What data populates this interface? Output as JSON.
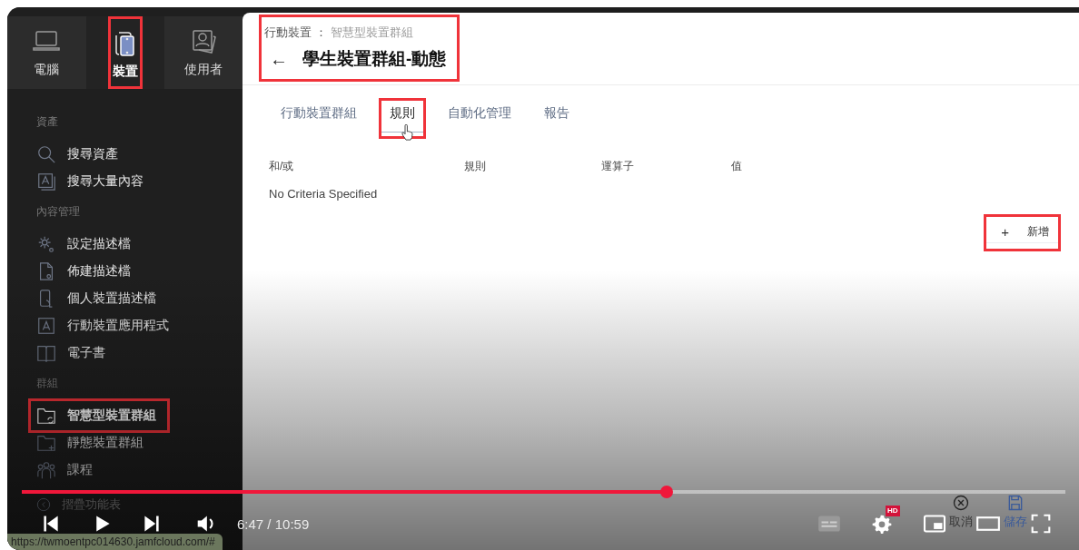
{
  "sidebar": {
    "tabs": [
      {
        "label": "電腦",
        "selected": false,
        "highlighted": false
      },
      {
        "label": "裝置",
        "selected": true,
        "highlighted": true
      },
      {
        "label": "使用者",
        "selected": false,
        "highlighted": false
      }
    ],
    "sections": [
      {
        "heading": "資產",
        "items": [
          {
            "label": "搜尋資產",
            "selected": false,
            "highlighted": false
          },
          {
            "label": "搜尋大量內容",
            "selected": false,
            "highlighted": false
          }
        ]
      },
      {
        "heading": "內容管理",
        "items": [
          {
            "label": "設定描述檔",
            "selected": false,
            "highlighted": false
          },
          {
            "label": "佈建描述檔",
            "selected": false,
            "highlighted": false
          },
          {
            "label": "個人裝置描述檔",
            "selected": false,
            "highlighted": false
          },
          {
            "label": "行動裝置應用程式",
            "selected": false,
            "highlighted": false
          },
          {
            "label": "電子書",
            "selected": false,
            "highlighted": false
          }
        ]
      },
      {
        "heading": "群組",
        "items": [
          {
            "label": "智慧型裝置群組",
            "selected": true,
            "highlighted": true
          },
          {
            "label": "靜態裝置群組",
            "selected": false,
            "highlighted": false
          },
          {
            "label": "課程",
            "selected": false,
            "highlighted": false
          }
        ]
      }
    ],
    "collapse": {
      "label": "摺疊功能表"
    }
  },
  "header": {
    "breadcrumb": {
      "parent": "行動裝置 ：",
      "current": "智慧型裝置群組"
    },
    "back": "←",
    "title": "學生裝置群組-動態",
    "highlighted": true
  },
  "tabs": [
    {
      "label": "行動裝置群組",
      "selected": false,
      "highlighted": false
    },
    {
      "label": "規則",
      "selected": true,
      "highlighted": true
    },
    {
      "label": "自動化管理",
      "selected": false,
      "highlighted": false
    },
    {
      "label": "報告",
      "selected": false,
      "highlighted": false
    }
  ],
  "criteria": {
    "columns": [
      "和/或",
      "規則",
      "運算子",
      "值"
    ],
    "empty_text": "No Criteria Specified",
    "add_button": {
      "icon": "+",
      "label": "新增",
      "highlighted": true
    }
  },
  "footer_actions": [
    {
      "kind": "cancel",
      "label": "取消"
    },
    {
      "kind": "save",
      "label": "儲存"
    }
  ],
  "player": {
    "progress": {
      "level": 0.618
    },
    "time": "6:47 / 10:59",
    "quality_badge": "HD"
  },
  "status_url": "https://twmoentpc014630.jamfcloud.com/#"
}
